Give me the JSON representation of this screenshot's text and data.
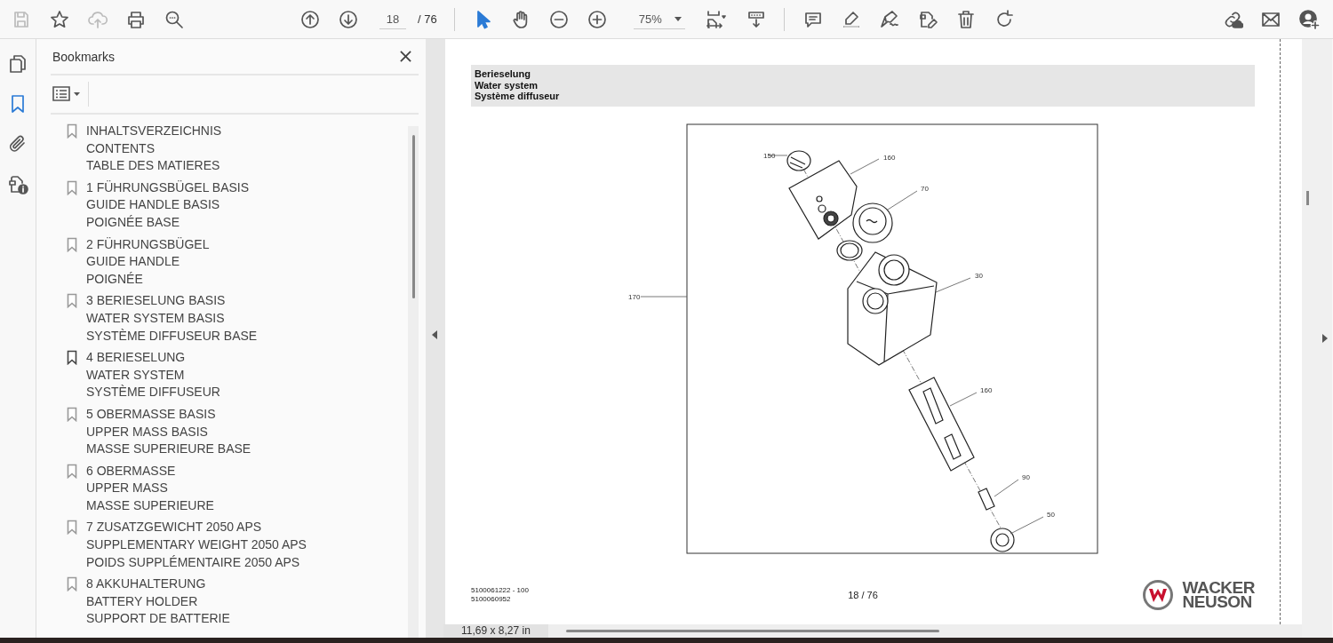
{
  "toolbar": {
    "file_tools": [
      {
        "disabled": true
      },
      {
        "disabled": false
      },
      {
        "disabled": true
      },
      {
        "disabled": false
      },
      {
        "disabled": false
      }
    ],
    "page_field": {
      "value": "18"
    },
    "page_total": "/ 76",
    "pointer_tools": [
      {
        "selected": true
      },
      {
        "selected": false
      }
    ],
    "zoom_field": {
      "value": "75%"
    }
  },
  "rail": [
    {
      "selected": false
    },
    {
      "selected": true
    },
    {
      "selected": false
    },
    {
      "selected": false
    }
  ],
  "sidebar": {
    "title": "Bookmarks",
    "bookmarks": [
      {
        "lines": [
          "INHALTSVERZEICHNIS",
          "CONTENTS",
          "TABLE DES MATIERES"
        ],
        "selected": false
      },
      {
        "lines": [
          "1 FÜHRUNGSBÜGEL BASIS",
          "GUIDE HANDLE BASIS",
          "POIGNÉE BASE"
        ],
        "selected": false
      },
      {
        "lines": [
          "2 FÜHRUNGSBÜGEL",
          "GUIDE HANDLE",
          "POIGNÉE"
        ],
        "selected": false
      },
      {
        "lines": [
          "3 BERIESELUNG BASIS",
          "WATER SYSTEM BASIS",
          "SYSTÈME DIFFUSEUR BASE"
        ],
        "selected": false
      },
      {
        "lines": [
          "4 BERIESELUNG",
          "WATER SYSTEM",
          "SYSTÈME DIFFUSEUR"
        ],
        "selected": true
      },
      {
        "lines": [
          "5 OBERMASSE BASIS",
          "UPPER MASS BASIS",
          "MASSE SUPERIEURE BASE"
        ],
        "selected": false
      },
      {
        "lines": [
          "6 OBERMASSE",
          "UPPER MASS",
          "MASSE SUPERIEURE"
        ],
        "selected": false
      },
      {
        "lines": [
          "7 ZUSATZGEWICHT 2050 APS",
          "SUPPLEMENTARY WEIGHT 2050 APS",
          "POIDS SUPPLÉMENTAIRE 2050 APS"
        ],
        "selected": false
      },
      {
        "lines": [
          "8 AKKUHALTERUNG",
          "BATTERY HOLDER",
          "SUPPORT DE BATTERIE"
        ],
        "selected": false
      }
    ]
  },
  "page": {
    "heading_lines": [
      "Berieselung",
      "Water system",
      "Système diffuseur"
    ],
    "callouts": [
      "150",
      "160",
      "70",
      "30",
      "160",
      "90",
      "50",
      "170"
    ],
    "footer": {
      "doc_numbers": [
        "5100061222 - 100",
        "5100060952"
      ],
      "page_number": "18 / 76",
      "brand_lines": [
        "WACKER",
        "NEUSON"
      ]
    }
  },
  "status_bar": {
    "page_size": "11,69 x 8,27 in"
  }
}
